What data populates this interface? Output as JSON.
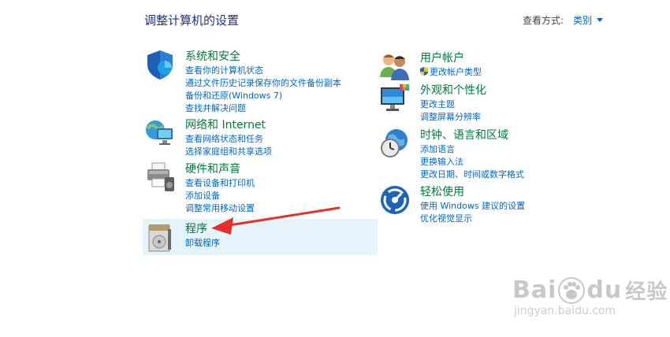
{
  "header": {
    "title": "调整计算机的设置",
    "view_by_label": "查看方式:",
    "view_by_value": "类别"
  },
  "categories_left": [
    {
      "title": "系统和安全",
      "links": [
        "查看你的计算机状态",
        "通过文件历史记录保存你的文件备份副本",
        "备份和还原(Windows 7)",
        "查找并解决问题"
      ]
    },
    {
      "title": "网络和 Internet",
      "links": [
        "查看网络状态和任务",
        "选择家庭组和共享选项"
      ]
    },
    {
      "title": "硬件和声音",
      "links": [
        "查看设备和打印机",
        "添加设备",
        "调整常用移动设置"
      ]
    },
    {
      "title": "程序",
      "links": [
        "卸载程序"
      ]
    }
  ],
  "categories_right": [
    {
      "title": "用户帐户",
      "links": [
        "更改帐户类型"
      ]
    },
    {
      "title": "外观和个性化",
      "links": [
        "更改主题",
        "调整屏幕分辨率"
      ]
    },
    {
      "title": "时钟、语言和区域",
      "links": [
        "添加语言",
        "更换输入法",
        "更改日期、时间或数字格式"
      ]
    },
    {
      "title": "轻松使用",
      "links": [
        "使用 Windows 建议的设置",
        "优化视觉显示"
      ]
    }
  ],
  "icons": [
    "shield-icon",
    "network-icon",
    "printer-icon",
    "programs-icon",
    "users-icon",
    "monitor-icon",
    "clock-globe-icon",
    "ease-of-access-icon"
  ],
  "watermark": {
    "brand": "Bai",
    "brand2": "du",
    "brand3": "经验",
    "url": "jingyan.baidu.com"
  },
  "colors": {
    "title": "#1e3287",
    "category": "#007a3d",
    "link": "#0066cc",
    "highlight": "#e5f3fb",
    "arrow": "#e8302a"
  }
}
